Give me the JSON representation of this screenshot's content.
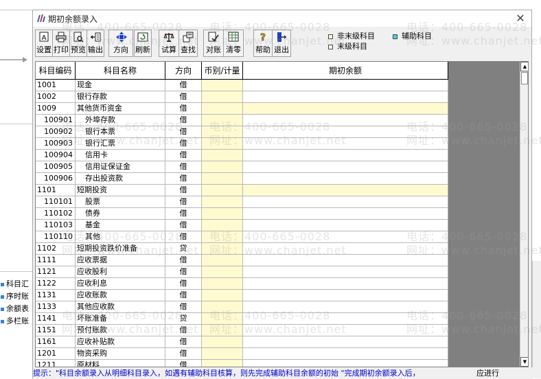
{
  "window": {
    "title": "期初余额录入",
    "close": "✕"
  },
  "toolbar": [
    {
      "label": "设置",
      "icon": "text-a-icon"
    },
    {
      "label": "打印",
      "icon": "printer-icon"
    },
    {
      "label": "预览",
      "icon": "preview-icon"
    },
    {
      "label": "输出",
      "icon": "export-icon"
    },
    {
      "label": "方向",
      "icon": "direction-arrows-icon"
    },
    {
      "label": "刷新",
      "icon": "refresh-icon"
    },
    {
      "label": "试算",
      "icon": "balance-scale-icon"
    },
    {
      "label": "查找",
      "icon": "find-icon"
    },
    {
      "label": "对账",
      "icon": "reconcile-icon"
    },
    {
      "label": "清零",
      "icon": "clear-grid-icon"
    },
    {
      "label": "帮助",
      "icon": "help-icon"
    },
    {
      "label": "退出",
      "icon": "exit-icon"
    }
  ],
  "legend": {
    "non_last": "非末级科目",
    "last": "末级科目",
    "auxiliary": "辅助科目",
    "aux_color": "#4fd1e0"
  },
  "table": {
    "columns": [
      "科目编码",
      "科目名称",
      "方向",
      "币别/计量",
      "期初余额"
    ],
    "rows": [
      {
        "code": "1001",
        "name": "现金",
        "dir": "借",
        "level": 1,
        "nonlast": false
      },
      {
        "code": "1002",
        "name": "银行存款",
        "dir": "借",
        "level": 1,
        "nonlast": false
      },
      {
        "code": "1009",
        "name": "其他货币资金",
        "dir": "借",
        "level": 1,
        "nonlast": true
      },
      {
        "code": "100901",
        "name": "外埠存款",
        "dir": "借",
        "level": 2,
        "nonlast": false
      },
      {
        "code": "100902",
        "name": "银行本票",
        "dir": "借",
        "level": 2,
        "nonlast": false
      },
      {
        "code": "100903",
        "name": "银行汇票",
        "dir": "借",
        "level": 2,
        "nonlast": false
      },
      {
        "code": "100904",
        "name": "信用卡",
        "dir": "借",
        "level": 2,
        "nonlast": false
      },
      {
        "code": "100905",
        "name": "信用证保证金",
        "dir": "借",
        "level": 2,
        "nonlast": false
      },
      {
        "code": "100906",
        "name": "存出投资款",
        "dir": "借",
        "level": 2,
        "nonlast": false
      },
      {
        "code": "1101",
        "name": "短期投资",
        "dir": "借",
        "level": 1,
        "nonlast": true
      },
      {
        "code": "110101",
        "name": "股票",
        "dir": "借",
        "level": 2,
        "nonlast": false
      },
      {
        "code": "110102",
        "name": "债券",
        "dir": "借",
        "level": 2,
        "nonlast": false
      },
      {
        "code": "110103",
        "name": "基金",
        "dir": "借",
        "level": 2,
        "nonlast": false
      },
      {
        "code": "110110",
        "name": "其他",
        "dir": "借",
        "level": 2,
        "nonlast": false
      },
      {
        "code": "1102",
        "name": "短期投资跌价准备",
        "dir": "贷",
        "level": 1,
        "nonlast": false
      },
      {
        "code": "1111",
        "name": "应收票据",
        "dir": "借",
        "level": 1,
        "nonlast": false
      },
      {
        "code": "1121",
        "name": "应收股利",
        "dir": "借",
        "level": 1,
        "nonlast": false
      },
      {
        "code": "1122",
        "name": "应收利息",
        "dir": "借",
        "level": 1,
        "nonlast": false
      },
      {
        "code": "1131",
        "name": "应收账款",
        "dir": "借",
        "level": 1,
        "nonlast": false
      },
      {
        "code": "1133",
        "name": "其他应收款",
        "dir": "借",
        "level": 1,
        "nonlast": false
      },
      {
        "code": "1141",
        "name": "坏账准备",
        "dir": "贷",
        "level": 1,
        "nonlast": false
      },
      {
        "code": "1151",
        "name": "预付账款",
        "dir": "借",
        "level": 1,
        "nonlast": false
      },
      {
        "code": "1161",
        "name": "应收补贴款",
        "dir": "借",
        "level": 1,
        "nonlast": false
      },
      {
        "code": "1201",
        "name": "物资采购",
        "dir": "借",
        "level": 1,
        "nonlast": false
      },
      {
        "code": "1211",
        "name": "原材料",
        "dir": "借",
        "level": 1,
        "nonlast": false
      }
    ]
  },
  "hint": {
    "text": "提示：\"科目余额录入从明细科目录入，如遇有辅助科目核算，则先完成辅助科目余额的初始 \"完成期初余额录入后，",
    "right": "应进行"
  },
  "background_nav": [
    "科目汇",
    "序时账",
    "余额表",
    "多栏账"
  ],
  "watermarks": {
    "phone": "电话：400-665-0028",
    "site": "网址：www.chanjet.net"
  }
}
